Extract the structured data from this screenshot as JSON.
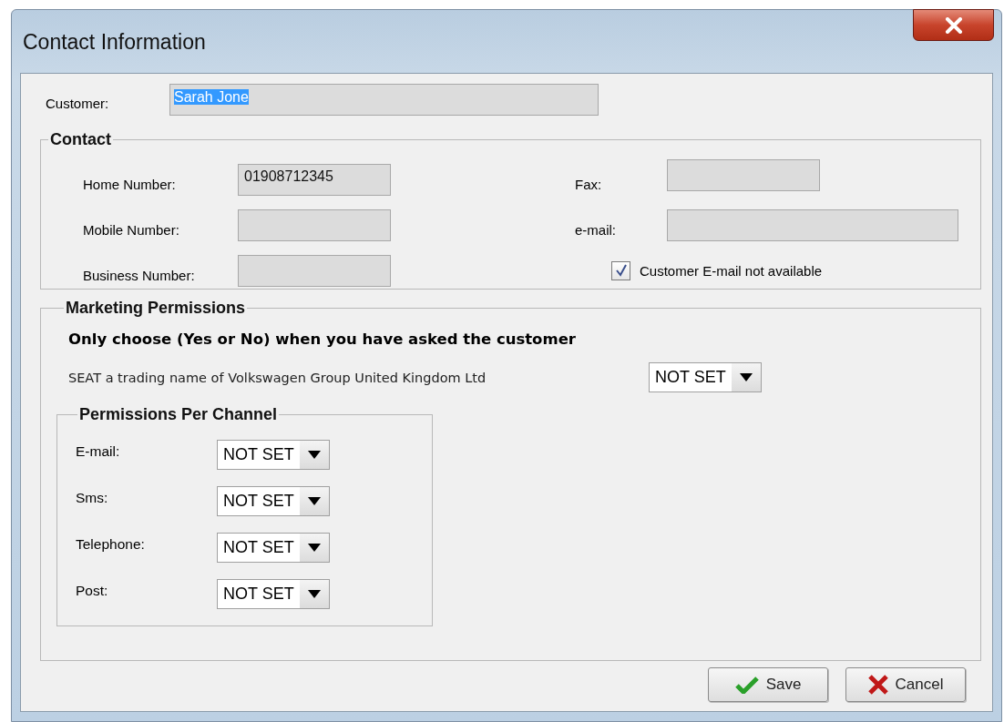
{
  "window": {
    "title": "Contact Information"
  },
  "customer": {
    "label": "Customer:",
    "value": "Sarah Jone",
    "selected": true
  },
  "contact": {
    "title": "Contact",
    "left_fields": [
      {
        "label": "Home Number:",
        "value": "01908712345"
      },
      {
        "label": "Mobile Number:"
      },
      {
        "label": "Business Number:"
      }
    ],
    "right_fields": [
      {
        "label": "Fax:",
        "kind": "short"
      },
      {
        "label": "e-mail:",
        "kind": "long"
      }
    ],
    "email_unavailable": {
      "label": "Customer E-mail not available",
      "checked": true
    }
  },
  "marketing": {
    "title": "Marketing Permissions",
    "instruction": "Only choose (Yes or No) when you have asked the customer",
    "company": {
      "label": "SEAT a trading name of Volkswagen Group United Kingdom Ltd",
      "value": "NOT SET"
    },
    "channels": {
      "title": "Permissions Per Channel",
      "items": [
        {
          "label": "E-mail:",
          "value": "NOT SET"
        },
        {
          "label": "Sms:",
          "value": "NOT SET"
        },
        {
          "label": "Telephone:",
          "value": "NOT SET"
        },
        {
          "label": "Post:",
          "value": "NOT SET"
        }
      ]
    }
  },
  "buttons": [
    {
      "label": "Save",
      "kind": "save"
    },
    {
      "label": "Cancel",
      "kind": "cancel"
    }
  ]
}
